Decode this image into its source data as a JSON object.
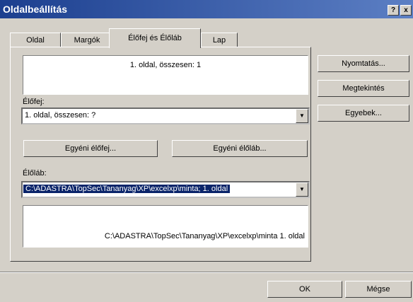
{
  "window": {
    "title": "Oldalbeállítás",
    "help": "?",
    "close": "x"
  },
  "tabs": [
    {
      "label": "Oldal"
    },
    {
      "label": "Margók"
    },
    {
      "label": "Élőfej és Élőláb"
    },
    {
      "label": "Lap"
    }
  ],
  "header_preview": {
    "text": "1. oldal, összesen: 1"
  },
  "header": {
    "label": "Élőfej:",
    "value": "1. oldal, összesen: ?"
  },
  "custom_buttons": {
    "header": "Egyéni élőfej...",
    "footer": "Egyéni élőláb..."
  },
  "footer": {
    "label": "Élőláb:",
    "value": "C:\\ADASTRA\\TopSec\\Tananyag\\XP\\excelxp\\minta; 1. oldal"
  },
  "footer_preview": {
    "text": "C:\\ADASTRA\\TopSec\\Tananyag\\XP\\excelxp\\minta 1. oldal"
  },
  "side_buttons": {
    "print": "Nyomtatás...",
    "preview": "Megtekintés",
    "options": "Egyebek..."
  },
  "bottom_buttons": {
    "ok": "OK",
    "cancel": "Mégse"
  }
}
